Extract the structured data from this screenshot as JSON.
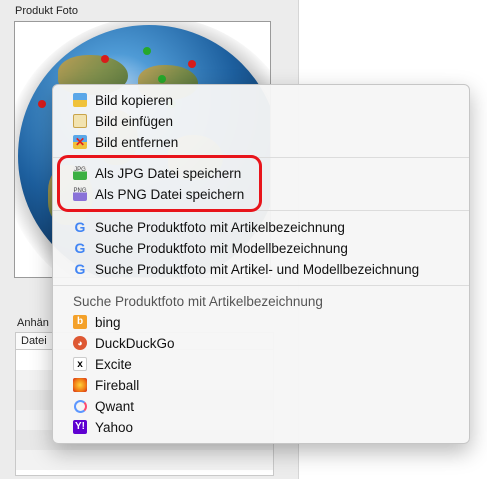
{
  "panel": {
    "photo_label": "Produkt Foto",
    "attachments_label": "Anhän",
    "table_header": "Datei"
  },
  "menu": {
    "image_items": [
      {
        "label": "Bild kopieren",
        "icon": "copy-icon"
      },
      {
        "label": "Bild einfügen",
        "icon": "paste-icon"
      },
      {
        "label": "Bild entfernen",
        "icon": "remove-icon"
      }
    ],
    "save_items": [
      {
        "label": "Als JPG Datei speichern",
        "icon": "jpg-file-icon",
        "icon_text": "JPG"
      },
      {
        "label": "Als PNG Datei speichern",
        "icon": "png-file-icon",
        "icon_text": "PNG"
      }
    ],
    "google_items": [
      {
        "label": "Suche Produktfoto mit Artikelbezeichnung",
        "icon": "google-icon"
      },
      {
        "label": "Suche Produktfoto mit Modellbezeichnung",
        "icon": "google-icon"
      },
      {
        "label": "Suche Produktfoto mit Artikel- und Modellbezeichnung",
        "icon": "google-icon"
      }
    ],
    "engine_header": "Suche Produktfoto mit Artikelbezeichnung",
    "engines": [
      {
        "label": "bing",
        "icon": "bing-icon"
      },
      {
        "label": "DuckDuckGo",
        "icon": "duckduckgo-icon"
      },
      {
        "label": "Excite",
        "icon": "excite-icon"
      },
      {
        "label": "Fireball",
        "icon": "fireball-icon"
      },
      {
        "label": "Qwant",
        "icon": "qwant-icon"
      },
      {
        "label": "Yahoo",
        "icon": "yahoo-icon"
      }
    ]
  },
  "colors": {
    "highlight": "#e8141b",
    "google_blue": "#4285f4",
    "google_red": "#ea4335",
    "bing_orange": "#f4a12a",
    "yahoo_purple": "#5f01d1"
  }
}
